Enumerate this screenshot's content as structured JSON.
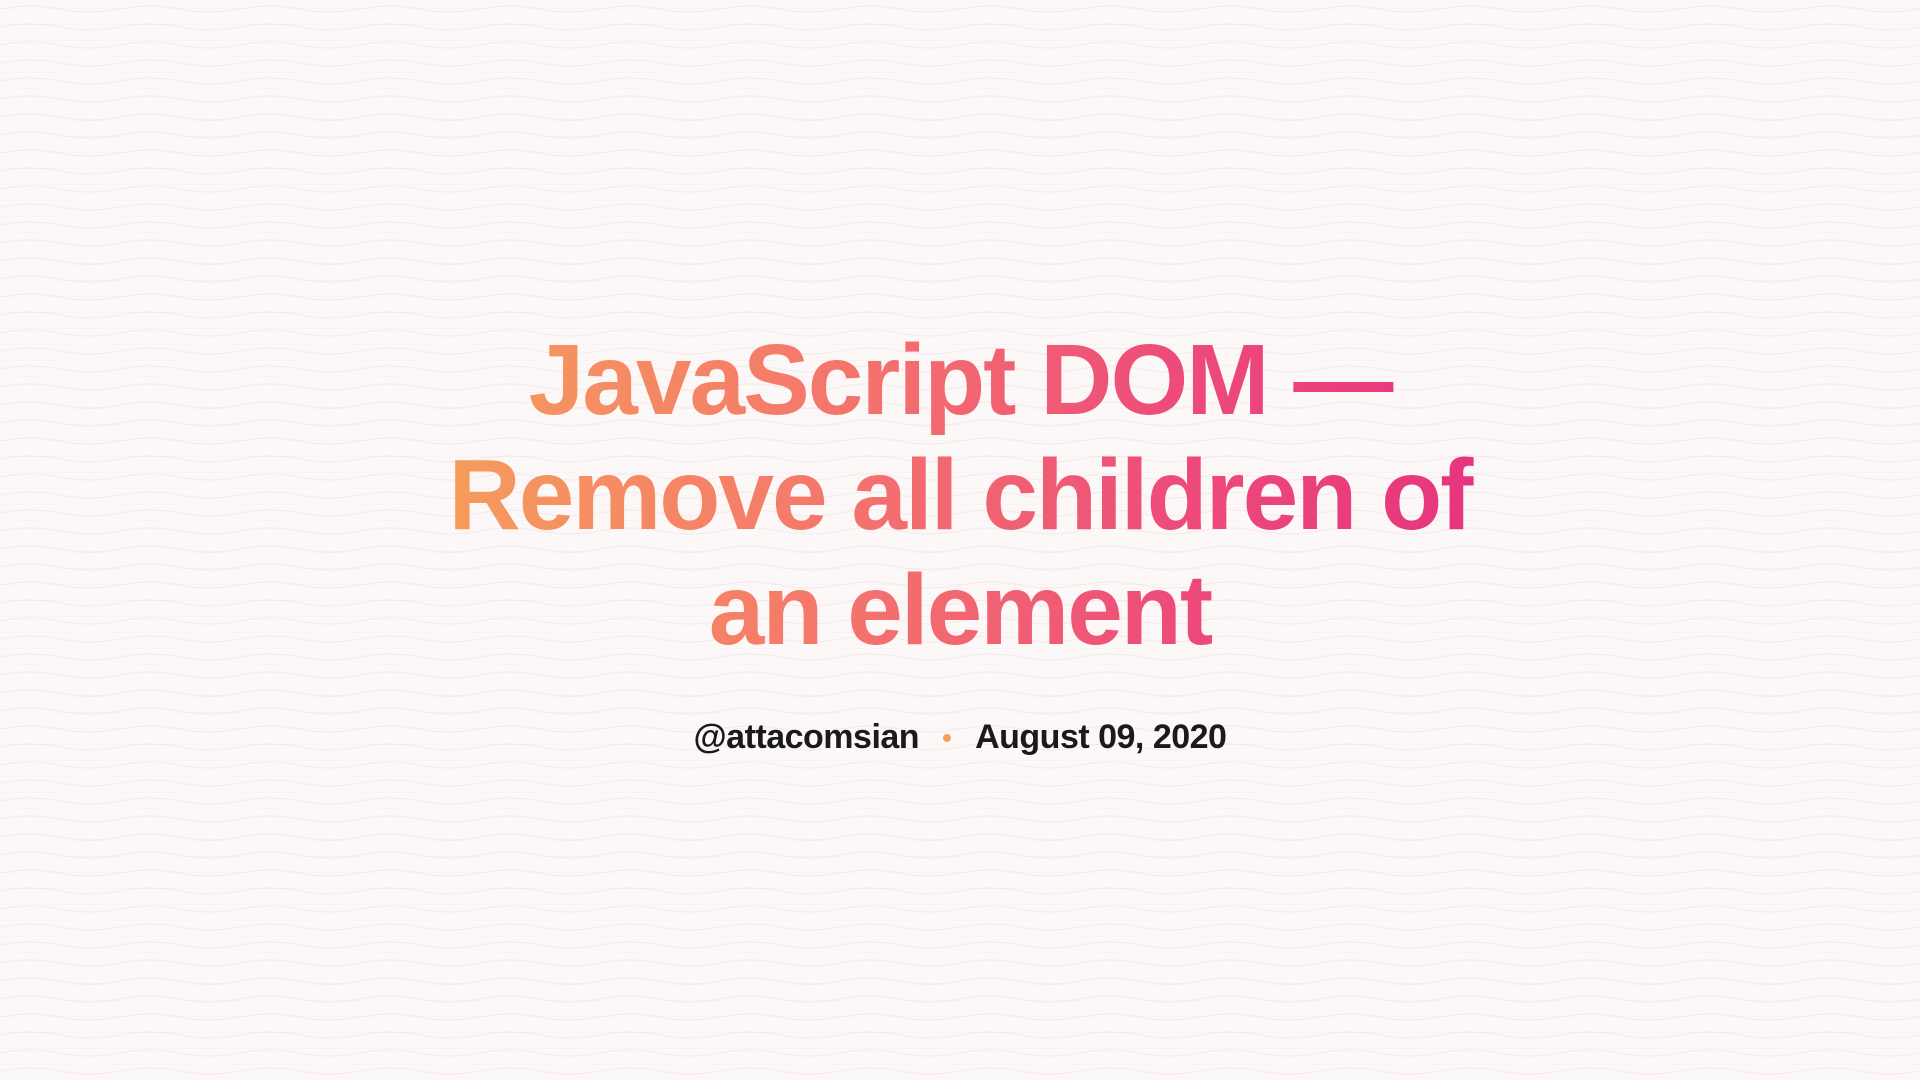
{
  "title": "JavaScript DOM — Remove all children of an element",
  "meta": {
    "author_handle": "@attacomsian",
    "date": "August 09, 2020"
  }
}
